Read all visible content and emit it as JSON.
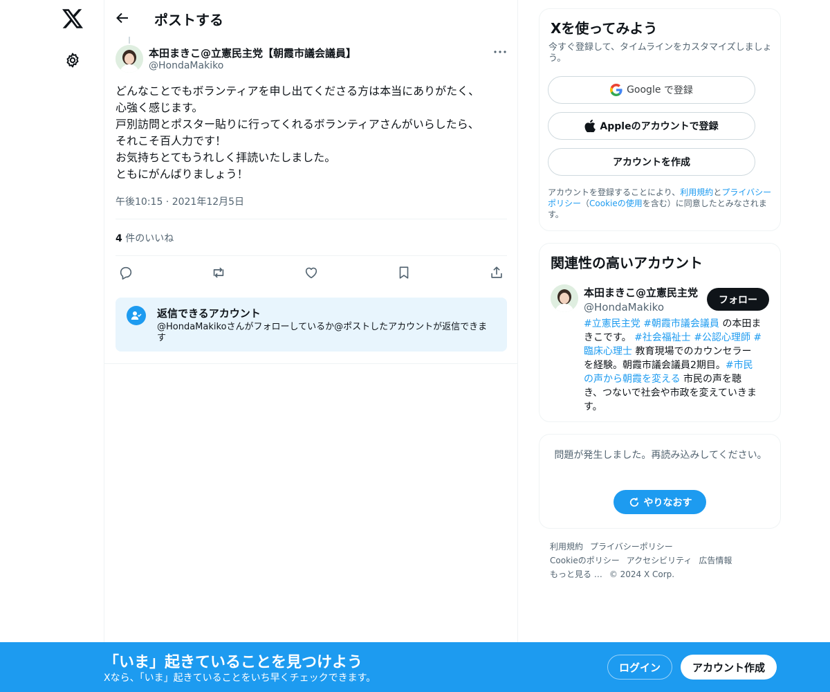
{
  "nav": {
    "logo_icon": "x-logo-icon",
    "settings_icon": "gear-icon"
  },
  "header": {
    "back_icon": "arrow-left-icon",
    "title": "ポストする"
  },
  "post": {
    "author_name": "本田まきこ@立憲民主党【朝霞市議会議員】",
    "author_handle": "@HondaMakiko",
    "more_icon": "more-horizontal-icon",
    "text_lines": [
      "どんなことでもボランティアを申し出てくださる方は本当にありがたく、",
      "心強く感じます。",
      "戸別訪問とポスター貼りに行ってくれるボランティアさんがいらしたら、",
      "それこそ百人力です！",
      "お気持ちとてもうれしく拝読いたしました。",
      "ともにがんばりましょう！"
    ],
    "timestamp": "午後10:15 · 2021年12月5日",
    "like_count": "4",
    "like_label": " 件のいいね",
    "actions": [
      "reply-icon",
      "repost-icon",
      "like-icon",
      "bookmark-icon",
      "share-icon"
    ]
  },
  "reply_restriction": {
    "title": "返信できるアカウント",
    "description": "@HondaMakikoさんがフォローしているか@ポストしたアカウントが返信できます"
  },
  "signup_card": {
    "title": "Xを使ってみよう",
    "subtitle": "今すぐ登録して、タイムラインをカスタマイズしましょう。",
    "google_label": "Google",
    "google_suffix": "で登録",
    "apple_label": "Appleのアカウントで登録",
    "create_label": "アカウントを作成",
    "legal_pre": "アカウントを登録することにより、",
    "legal_terms": "利用規約",
    "legal_and": "と",
    "legal_privacy": "プライバシーポリシー",
    "legal_mid": "（",
    "legal_cookie": "Cookieの使用",
    "legal_post": "を含む）に同意したとみなされます。"
  },
  "related_card": {
    "title": "関連性の高いアカウント",
    "name": "本田まきこ@立憲民主党",
    "handle": "@HondaMakiko",
    "follow_label": "フォロー",
    "bio_lines": [
      [
        {
          "t": "#立憲民主党",
          "tag": true
        },
        {
          "t": " ",
          "tag": false
        },
        {
          "t": "#朝霞市議会議員",
          "tag": true
        },
        {
          "t": " の本田ま",
          "tag": false
        }
      ],
      [
        {
          "t": "きこです。 ",
          "tag": false
        },
        {
          "t": "#社会福祉士",
          "tag": true
        },
        {
          "t": " ",
          "tag": false
        },
        {
          "t": "#公認心理師",
          "tag": true
        },
        {
          "t": " #",
          "tag": true
        }
      ],
      [
        {
          "t": "臨床心理士",
          "tag": true
        },
        {
          "t": " 教育現場でのカウンセラー",
          "tag": false
        }
      ],
      [
        {
          "t": "を経験。朝霞市議会議員2期目。",
          "tag": false
        },
        {
          "t": "#市民",
          "tag": true
        }
      ],
      [
        {
          "t": "の声から朝霞を変える",
          "tag": true
        },
        {
          "t": " 市民の声を聴",
          "tag": false
        }
      ],
      [
        {
          "t": "き、つないで社会や市政を変えていきま",
          "tag": false
        }
      ],
      [
        {
          "t": "す。",
          "tag": false
        }
      ]
    ]
  },
  "error_card": {
    "message": "問題が発生しました。再読み込みしてください。",
    "retry_label": "やりなおす"
  },
  "footer": {
    "links": [
      "利用規約",
      "プライバシーポリシー",
      "Cookieのポリシー",
      "アクセシビリティ",
      "広告情報",
      "もっと見る …"
    ],
    "copyright": "© 2024 X Corp."
  },
  "banner": {
    "title": "「いま」起きていることを見つけよう",
    "subtitle": "Xなら、「いま」起きていることをいち早くチェックできます。",
    "login_label": "ログイン",
    "signup_label": "アカウント作成"
  },
  "colors": {
    "accent": "#1d9bf0",
    "text": "#0f1419",
    "secondary": "#536471",
    "reply_box_bg": "#e8f5fd"
  }
}
